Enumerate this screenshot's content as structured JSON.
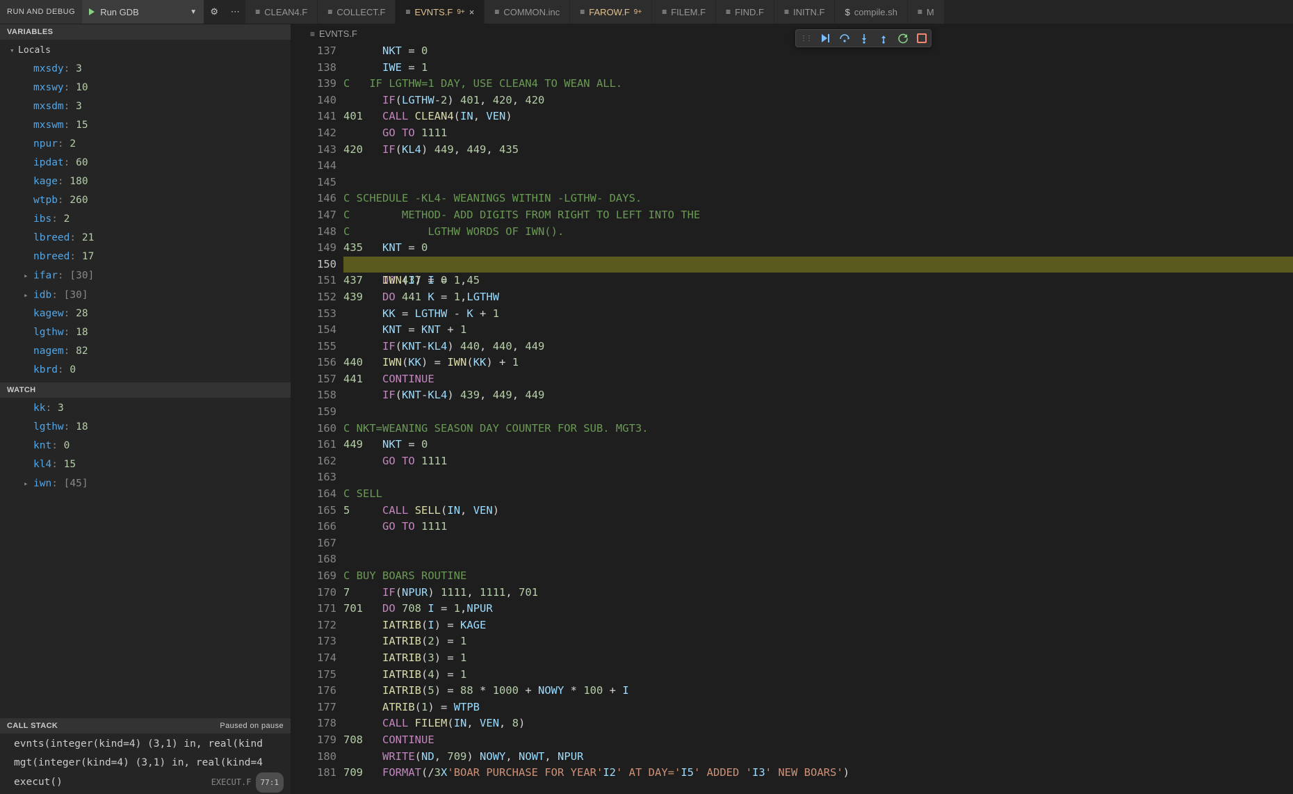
{
  "topbar": {
    "run_debug_label": "RUN AND DEBUG",
    "config_name": "Run GDB"
  },
  "tabs": [
    {
      "label": "CLEAN4.F",
      "mod": false,
      "active": false,
      "icon": "≡"
    },
    {
      "label": "COLLECT.F",
      "mod": false,
      "active": false,
      "icon": "≡"
    },
    {
      "label": "EVNTS.F",
      "mod": true,
      "active": true,
      "badge": "9+",
      "icon": "≡",
      "close": true
    },
    {
      "label": "COMMON.inc",
      "mod": false,
      "active": false,
      "icon": "≡"
    },
    {
      "label": "FAROW.F",
      "mod": true,
      "active": false,
      "badge": "9+",
      "icon": "≡"
    },
    {
      "label": "FILEM.F",
      "mod": false,
      "active": false,
      "icon": "≡"
    },
    {
      "label": "FIND.F",
      "mod": false,
      "active": false,
      "icon": "≡"
    },
    {
      "label": "INITN.F",
      "mod": false,
      "active": false,
      "icon": "≡"
    },
    {
      "label": "compile.sh",
      "mod": false,
      "active": false,
      "icon": "$"
    },
    {
      "label": "M",
      "mod": false,
      "active": false,
      "icon": "≡",
      "trunc": true
    }
  ],
  "sections": {
    "variables": "VARIABLES",
    "locals": "Locals",
    "watch": "WATCH",
    "callstack": "CALL STACK",
    "callstack_state": "Paused on pause"
  },
  "locals": [
    {
      "name": "mxsdy",
      "val": "3"
    },
    {
      "name": "mxswy",
      "val": "10"
    },
    {
      "name": "mxsdm",
      "val": "3"
    },
    {
      "name": "mxswm",
      "val": "15"
    },
    {
      "name": "npur",
      "val": "2"
    },
    {
      "name": "ipdat",
      "val": "60"
    },
    {
      "name": "kage",
      "val": "180"
    },
    {
      "name": "wtpb",
      "val": "260"
    },
    {
      "name": "ibs",
      "val": "2"
    },
    {
      "name": "lbreed",
      "val": "21"
    },
    {
      "name": "nbreed",
      "val": "17"
    },
    {
      "name": "ifar",
      "val": "[30]",
      "exp": true
    },
    {
      "name": "idb",
      "val": "[30]",
      "exp": true
    },
    {
      "name": "kagew",
      "val": "28"
    },
    {
      "name": "lgthw",
      "val": "18"
    },
    {
      "name": "nagem",
      "val": "82"
    },
    {
      "name": "kbrd",
      "val": "0"
    }
  ],
  "watch": [
    {
      "name": "kk",
      "val": "3"
    },
    {
      "name": "lgthw",
      "val": "18"
    },
    {
      "name": "knt",
      "val": "0"
    },
    {
      "name": "kl4",
      "val": "15"
    },
    {
      "name": "iwn",
      "val": "[45]",
      "exp": true
    }
  ],
  "callstack": [
    {
      "name": "evnts(integer(kind=4) (3,1) in, real(kind"
    },
    {
      "name": "mgt(integer(kind=4) (3,1) in, real(kind=4"
    },
    {
      "name": "execut()",
      "file": "EXECUT.F",
      "badge": "77:1"
    }
  ],
  "breadcrumb": "EVNTS.F",
  "current_line": 150,
  "code_first_line": 137,
  "code_lines": [
    {
      "n": 137,
      "seg": [
        [
          "      ",
          ""
        ],
        [
          "NKT",
          " c-var"
        ],
        [
          " = ",
          "c-op"
        ],
        [
          "0",
          "c-num"
        ]
      ]
    },
    {
      "n": 138,
      "seg": [
        [
          "      ",
          ""
        ],
        [
          "IWE",
          " c-var"
        ],
        [
          " = ",
          "c-op"
        ],
        [
          "1",
          "c-num"
        ]
      ]
    },
    {
      "n": 139,
      "seg": [
        [
          "C   IF LGTHW=1 DAY, USE CLEAN4 TO WEAN ALL.",
          "c-cmt"
        ]
      ]
    },
    {
      "n": 140,
      "seg": [
        [
          "      ",
          ""
        ],
        [
          "IF",
          "c-kw"
        ],
        [
          "(",
          "c-op"
        ],
        [
          "LGTHW",
          "c-var"
        ],
        [
          "-",
          "c-op"
        ],
        [
          "2",
          "c-num"
        ],
        [
          ") ",
          "c-op"
        ],
        [
          "401",
          "c-num"
        ],
        [
          ", ",
          "c-op"
        ],
        [
          "420",
          "c-num"
        ],
        [
          ", ",
          "c-op"
        ],
        [
          "420",
          "c-num"
        ]
      ]
    },
    {
      "n": 141,
      "seg": [
        [
          "401",
          "c-lbl"
        ],
        [
          "   ",
          ""
        ],
        [
          "CALL ",
          "c-kw"
        ],
        [
          "CLEAN4",
          "c-fn"
        ],
        [
          "(",
          "c-op"
        ],
        [
          "IN",
          "c-var"
        ],
        [
          ", ",
          "c-op"
        ],
        [
          "VEN",
          "c-var"
        ],
        [
          ")",
          "c-op"
        ]
      ]
    },
    {
      "n": 142,
      "seg": [
        [
          "      ",
          ""
        ],
        [
          "GO TO ",
          "c-kw"
        ],
        [
          "1111",
          "c-num"
        ]
      ]
    },
    {
      "n": 143,
      "seg": [
        [
          "420",
          "c-lbl"
        ],
        [
          "   ",
          ""
        ],
        [
          "IF",
          "c-kw"
        ],
        [
          "(",
          "c-op"
        ],
        [
          "KL4",
          "c-var"
        ],
        [
          ") ",
          "c-op"
        ],
        [
          "449",
          "c-num"
        ],
        [
          ", ",
          "c-op"
        ],
        [
          "449",
          "c-num"
        ],
        [
          ", ",
          "c-op"
        ],
        [
          "435",
          "c-num"
        ]
      ]
    },
    {
      "n": 144,
      "seg": [
        [
          "",
          ""
        ]
      ]
    },
    {
      "n": 145,
      "seg": [
        [
          "",
          ""
        ]
      ]
    },
    {
      "n": 146,
      "seg": [
        [
          "C SCHEDULE -KL4- WEANINGS WITHIN -LGTHW- DAYS.",
          "c-cmt"
        ]
      ]
    },
    {
      "n": 147,
      "seg": [
        [
          "C        METHOD- ADD DIGITS FROM RIGHT TO LEFT INTO THE",
          "c-cmt"
        ]
      ]
    },
    {
      "n": 148,
      "seg": [
        [
          "C            LGTHW WORDS OF IWN().",
          "c-cmt"
        ]
      ]
    },
    {
      "n": 149,
      "seg": [
        [
          "435",
          "c-lbl"
        ],
        [
          "   ",
          ""
        ],
        [
          "KNT",
          "c-var"
        ],
        [
          " = ",
          "c-op"
        ],
        [
          "0",
          "c-num"
        ]
      ]
    },
    {
      "n": 150,
      "seg": [
        [
          "      ",
          ""
        ],
        [
          "DO ",
          "c-kw"
        ],
        [
          "437",
          "c-num"
        ],
        [
          " ",
          "c-op"
        ],
        [
          "I",
          "c-var"
        ],
        [
          " = ",
          "c-op"
        ],
        [
          "1",
          "c-num"
        ],
        [
          ",",
          "c-op"
        ],
        [
          "45",
          "c-num"
        ]
      ],
      "current": true
    },
    {
      "n": 151,
      "seg": [
        [
          "437",
          "c-lbl"
        ],
        [
          "   ",
          ""
        ],
        [
          "IWN",
          "c-fn"
        ],
        [
          "(",
          "c-op"
        ],
        [
          "I",
          "c-var"
        ],
        [
          ") = ",
          "c-op"
        ],
        [
          "0",
          "c-num"
        ]
      ]
    },
    {
      "n": 152,
      "seg": [
        [
          "439",
          "c-lbl"
        ],
        [
          "   ",
          ""
        ],
        [
          "DO ",
          "c-kw"
        ],
        [
          "441",
          "c-num"
        ],
        [
          " ",
          "c-op"
        ],
        [
          "K",
          "c-var"
        ],
        [
          " = ",
          "c-op"
        ],
        [
          "1",
          "c-num"
        ],
        [
          ",",
          "c-op"
        ],
        [
          "LGTHW",
          "c-var"
        ]
      ]
    },
    {
      "n": 153,
      "seg": [
        [
          "      ",
          ""
        ],
        [
          "KK",
          "c-var"
        ],
        [
          " = ",
          "c-op"
        ],
        [
          "LGTHW",
          "c-var"
        ],
        [
          " - ",
          "c-op"
        ],
        [
          "K",
          "c-var"
        ],
        [
          " + ",
          "c-op"
        ],
        [
          "1",
          "c-num"
        ]
      ]
    },
    {
      "n": 154,
      "seg": [
        [
          "      ",
          ""
        ],
        [
          "KNT",
          "c-var"
        ],
        [
          " = ",
          "c-op"
        ],
        [
          "KNT",
          "c-var"
        ],
        [
          " + ",
          "c-op"
        ],
        [
          "1",
          "c-num"
        ]
      ]
    },
    {
      "n": 155,
      "seg": [
        [
          "      ",
          ""
        ],
        [
          "IF",
          "c-kw"
        ],
        [
          "(",
          "c-op"
        ],
        [
          "KNT",
          "c-var"
        ],
        [
          "-",
          "c-op"
        ],
        [
          "KL4",
          "c-var"
        ],
        [
          ") ",
          "c-op"
        ],
        [
          "440",
          "c-num"
        ],
        [
          ", ",
          "c-op"
        ],
        [
          "440",
          "c-num"
        ],
        [
          ", ",
          "c-op"
        ],
        [
          "449",
          "c-num"
        ]
      ]
    },
    {
      "n": 156,
      "seg": [
        [
          "440",
          "c-lbl"
        ],
        [
          "   ",
          ""
        ],
        [
          "IWN",
          "c-fn"
        ],
        [
          "(",
          "c-op"
        ],
        [
          "KK",
          "c-var"
        ],
        [
          ") = ",
          "c-op"
        ],
        [
          "IWN",
          "c-fn"
        ],
        [
          "(",
          "c-op"
        ],
        [
          "KK",
          "c-var"
        ],
        [
          ") + ",
          "c-op"
        ],
        [
          "1",
          "c-num"
        ]
      ]
    },
    {
      "n": 157,
      "seg": [
        [
          "441",
          "c-lbl"
        ],
        [
          "   ",
          ""
        ],
        [
          "CONTINUE",
          "c-kw"
        ]
      ]
    },
    {
      "n": 158,
      "seg": [
        [
          "      ",
          ""
        ],
        [
          "IF",
          "c-kw"
        ],
        [
          "(",
          "c-op"
        ],
        [
          "KNT",
          "c-var"
        ],
        [
          "-",
          "c-op"
        ],
        [
          "KL4",
          "c-var"
        ],
        [
          ") ",
          "c-op"
        ],
        [
          "439",
          "c-num"
        ],
        [
          ", ",
          "c-op"
        ],
        [
          "449",
          "c-num"
        ],
        [
          ", ",
          "c-op"
        ],
        [
          "449",
          "c-num"
        ]
      ]
    },
    {
      "n": 159,
      "seg": [
        [
          "",
          ""
        ]
      ]
    },
    {
      "n": 160,
      "seg": [
        [
          "C NKT=WEANING SEASON DAY COUNTER FOR SUB. MGT3.",
          "c-cmt"
        ]
      ]
    },
    {
      "n": 161,
      "seg": [
        [
          "449",
          "c-lbl"
        ],
        [
          "   ",
          ""
        ],
        [
          "NKT",
          "c-var"
        ],
        [
          " = ",
          "c-op"
        ],
        [
          "0",
          "c-num"
        ]
      ]
    },
    {
      "n": 162,
      "seg": [
        [
          "      ",
          ""
        ],
        [
          "GO TO ",
          "c-kw"
        ],
        [
          "1111",
          "c-num"
        ]
      ]
    },
    {
      "n": 163,
      "seg": [
        [
          "",
          ""
        ]
      ]
    },
    {
      "n": 164,
      "seg": [
        [
          "C SELL",
          "c-cmt"
        ]
      ]
    },
    {
      "n": 165,
      "seg": [
        [
          "5",
          "c-lbl"
        ],
        [
          "     ",
          ""
        ],
        [
          "CALL ",
          "c-kw"
        ],
        [
          "SELL",
          "c-fn"
        ],
        [
          "(",
          "c-op"
        ],
        [
          "IN",
          "c-var"
        ],
        [
          ", ",
          "c-op"
        ],
        [
          "VEN",
          "c-var"
        ],
        [
          ")",
          "c-op"
        ]
      ]
    },
    {
      "n": 166,
      "seg": [
        [
          "      ",
          ""
        ],
        [
          "GO TO ",
          "c-kw"
        ],
        [
          "1111",
          "c-num"
        ]
      ]
    },
    {
      "n": 167,
      "seg": [
        [
          "",
          ""
        ]
      ]
    },
    {
      "n": 168,
      "seg": [
        [
          "",
          ""
        ]
      ]
    },
    {
      "n": 169,
      "seg": [
        [
          "C BUY BOARS ROUTINE",
          "c-cmt"
        ]
      ]
    },
    {
      "n": 170,
      "seg": [
        [
          "7",
          "c-lbl"
        ],
        [
          "     ",
          ""
        ],
        [
          "IF",
          "c-kw"
        ],
        [
          "(",
          "c-op"
        ],
        [
          "NPUR",
          "c-var"
        ],
        [
          ") ",
          "c-op"
        ],
        [
          "1111",
          "c-num"
        ],
        [
          ", ",
          "c-op"
        ],
        [
          "1111",
          "c-num"
        ],
        [
          ", ",
          "c-op"
        ],
        [
          "701",
          "c-num"
        ]
      ]
    },
    {
      "n": 171,
      "seg": [
        [
          "701",
          "c-lbl"
        ],
        [
          "   ",
          ""
        ],
        [
          "DO ",
          "c-kw"
        ],
        [
          "708",
          "c-num"
        ],
        [
          " ",
          "c-op"
        ],
        [
          "I",
          "c-var"
        ],
        [
          " = ",
          "c-op"
        ],
        [
          "1",
          "c-num"
        ],
        [
          ",",
          "c-op"
        ],
        [
          "NPUR",
          "c-var"
        ]
      ]
    },
    {
      "n": 172,
      "seg": [
        [
          "      ",
          ""
        ],
        [
          "IATRIB",
          "c-fn"
        ],
        [
          "(",
          "c-op"
        ],
        [
          "I",
          "c-var"
        ],
        [
          ") = ",
          "c-op"
        ],
        [
          "KAGE",
          "c-var"
        ]
      ]
    },
    {
      "n": 173,
      "seg": [
        [
          "      ",
          ""
        ],
        [
          "IATRIB",
          "c-fn"
        ],
        [
          "(",
          "c-op"
        ],
        [
          "2",
          "c-num"
        ],
        [
          ") = ",
          "c-op"
        ],
        [
          "1",
          "c-num"
        ]
      ]
    },
    {
      "n": 174,
      "seg": [
        [
          "      ",
          ""
        ],
        [
          "IATRIB",
          "c-fn"
        ],
        [
          "(",
          "c-op"
        ],
        [
          "3",
          "c-num"
        ],
        [
          ") = ",
          "c-op"
        ],
        [
          "1",
          "c-num"
        ]
      ]
    },
    {
      "n": 175,
      "seg": [
        [
          "      ",
          ""
        ],
        [
          "IATRIB",
          "c-fn"
        ],
        [
          "(",
          "c-op"
        ],
        [
          "4",
          "c-num"
        ],
        [
          ") = ",
          "c-op"
        ],
        [
          "1",
          "c-num"
        ]
      ]
    },
    {
      "n": 176,
      "seg": [
        [
          "      ",
          ""
        ],
        [
          "IATRIB",
          "c-fn"
        ],
        [
          "(",
          "c-op"
        ],
        [
          "5",
          "c-num"
        ],
        [
          ") = ",
          "c-op"
        ],
        [
          "88",
          "c-num"
        ],
        [
          " * ",
          "c-op"
        ],
        [
          "1000",
          "c-num"
        ],
        [
          " + ",
          "c-op"
        ],
        [
          "NOWY",
          "c-var"
        ],
        [
          " * ",
          "c-op"
        ],
        [
          "100",
          "c-num"
        ],
        [
          " + ",
          "c-op"
        ],
        [
          "I",
          "c-var"
        ]
      ]
    },
    {
      "n": 177,
      "seg": [
        [
          "      ",
          ""
        ],
        [
          "ATRIB",
          "c-fn"
        ],
        [
          "(",
          "c-op"
        ],
        [
          "1",
          "c-num"
        ],
        [
          ") = ",
          "c-op"
        ],
        [
          "WTPB",
          "c-var"
        ]
      ]
    },
    {
      "n": 178,
      "seg": [
        [
          "      ",
          ""
        ],
        [
          "CALL ",
          "c-kw"
        ],
        [
          "FILEM",
          "c-fn"
        ],
        [
          "(",
          "c-op"
        ],
        [
          "IN",
          "c-var"
        ],
        [
          ", ",
          "c-op"
        ],
        [
          "VEN",
          "c-var"
        ],
        [
          ", ",
          "c-op"
        ],
        [
          "8",
          "c-num"
        ],
        [
          ")",
          "c-op"
        ]
      ]
    },
    {
      "n": 179,
      "seg": [
        [
          "708",
          "c-lbl"
        ],
        [
          "   ",
          ""
        ],
        [
          "CONTINUE",
          "c-kw"
        ]
      ]
    },
    {
      "n": 180,
      "seg": [
        [
          "      ",
          ""
        ],
        [
          "WRITE",
          "c-kw"
        ],
        [
          "(",
          "c-op"
        ],
        [
          "ND",
          "c-var"
        ],
        [
          ", ",
          "c-op"
        ],
        [
          "709",
          "c-num"
        ],
        [
          ") ",
          "c-op"
        ],
        [
          "NOWY",
          "c-var"
        ],
        [
          ", ",
          "c-op"
        ],
        [
          "NOWT",
          "c-var"
        ],
        [
          ", ",
          "c-op"
        ],
        [
          "NPUR",
          "c-var"
        ]
      ]
    },
    {
      "n": 181,
      "seg": [
        [
          "709",
          "c-lbl"
        ],
        [
          "   ",
          ""
        ],
        [
          "FORMAT",
          "c-kw"
        ],
        [
          "(/",
          "c-op"
        ],
        [
          "3",
          "c-num"
        ],
        [
          "X",
          "c-var"
        ],
        [
          "'BOAR PURCHASE FOR YEAR'",
          "c-str"
        ],
        [
          "I2",
          "c-var"
        ],
        [
          "' AT DAY='",
          "c-str"
        ],
        [
          "I5",
          "c-var"
        ],
        [
          "' ADDED '",
          "c-str"
        ],
        [
          "I3",
          "c-var"
        ],
        [
          "' NEW BOARS'",
          "c-str"
        ],
        [
          ")",
          "c-op"
        ]
      ]
    }
  ]
}
